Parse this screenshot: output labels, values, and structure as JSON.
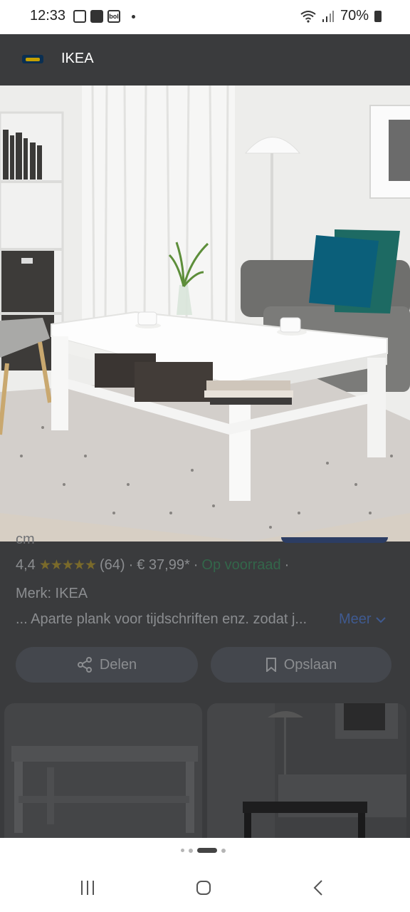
{
  "status_bar": {
    "time": "12:33",
    "notification_icons": [
      "save-icon",
      "gallery-icon",
      "bol-icon"
    ],
    "bol_label": "bol",
    "battery": "70%"
  },
  "app_bar": {
    "title": "IKEA",
    "logo": "ikea-logo"
  },
  "product": {
    "title_fragment": "cm",
    "rating": "4,4",
    "stars": "★★★★★",
    "review_count": "(64)",
    "separator": "·",
    "price": "€ 37,99*",
    "stock": "Op voorraad",
    "brand": "Merk: IKEA",
    "description": "... Aparte plank voor tijdschriften enz. zodat j...",
    "more_label": "Meer"
  },
  "actions": {
    "share_label": "Delen",
    "save_label": "Opslaan"
  },
  "carousel": {
    "count": 4,
    "active_index": 2
  },
  "colors": {
    "overlay": "#3a3b3d",
    "stock_green": "#33664a",
    "link_blue": "#3f5a90"
  }
}
